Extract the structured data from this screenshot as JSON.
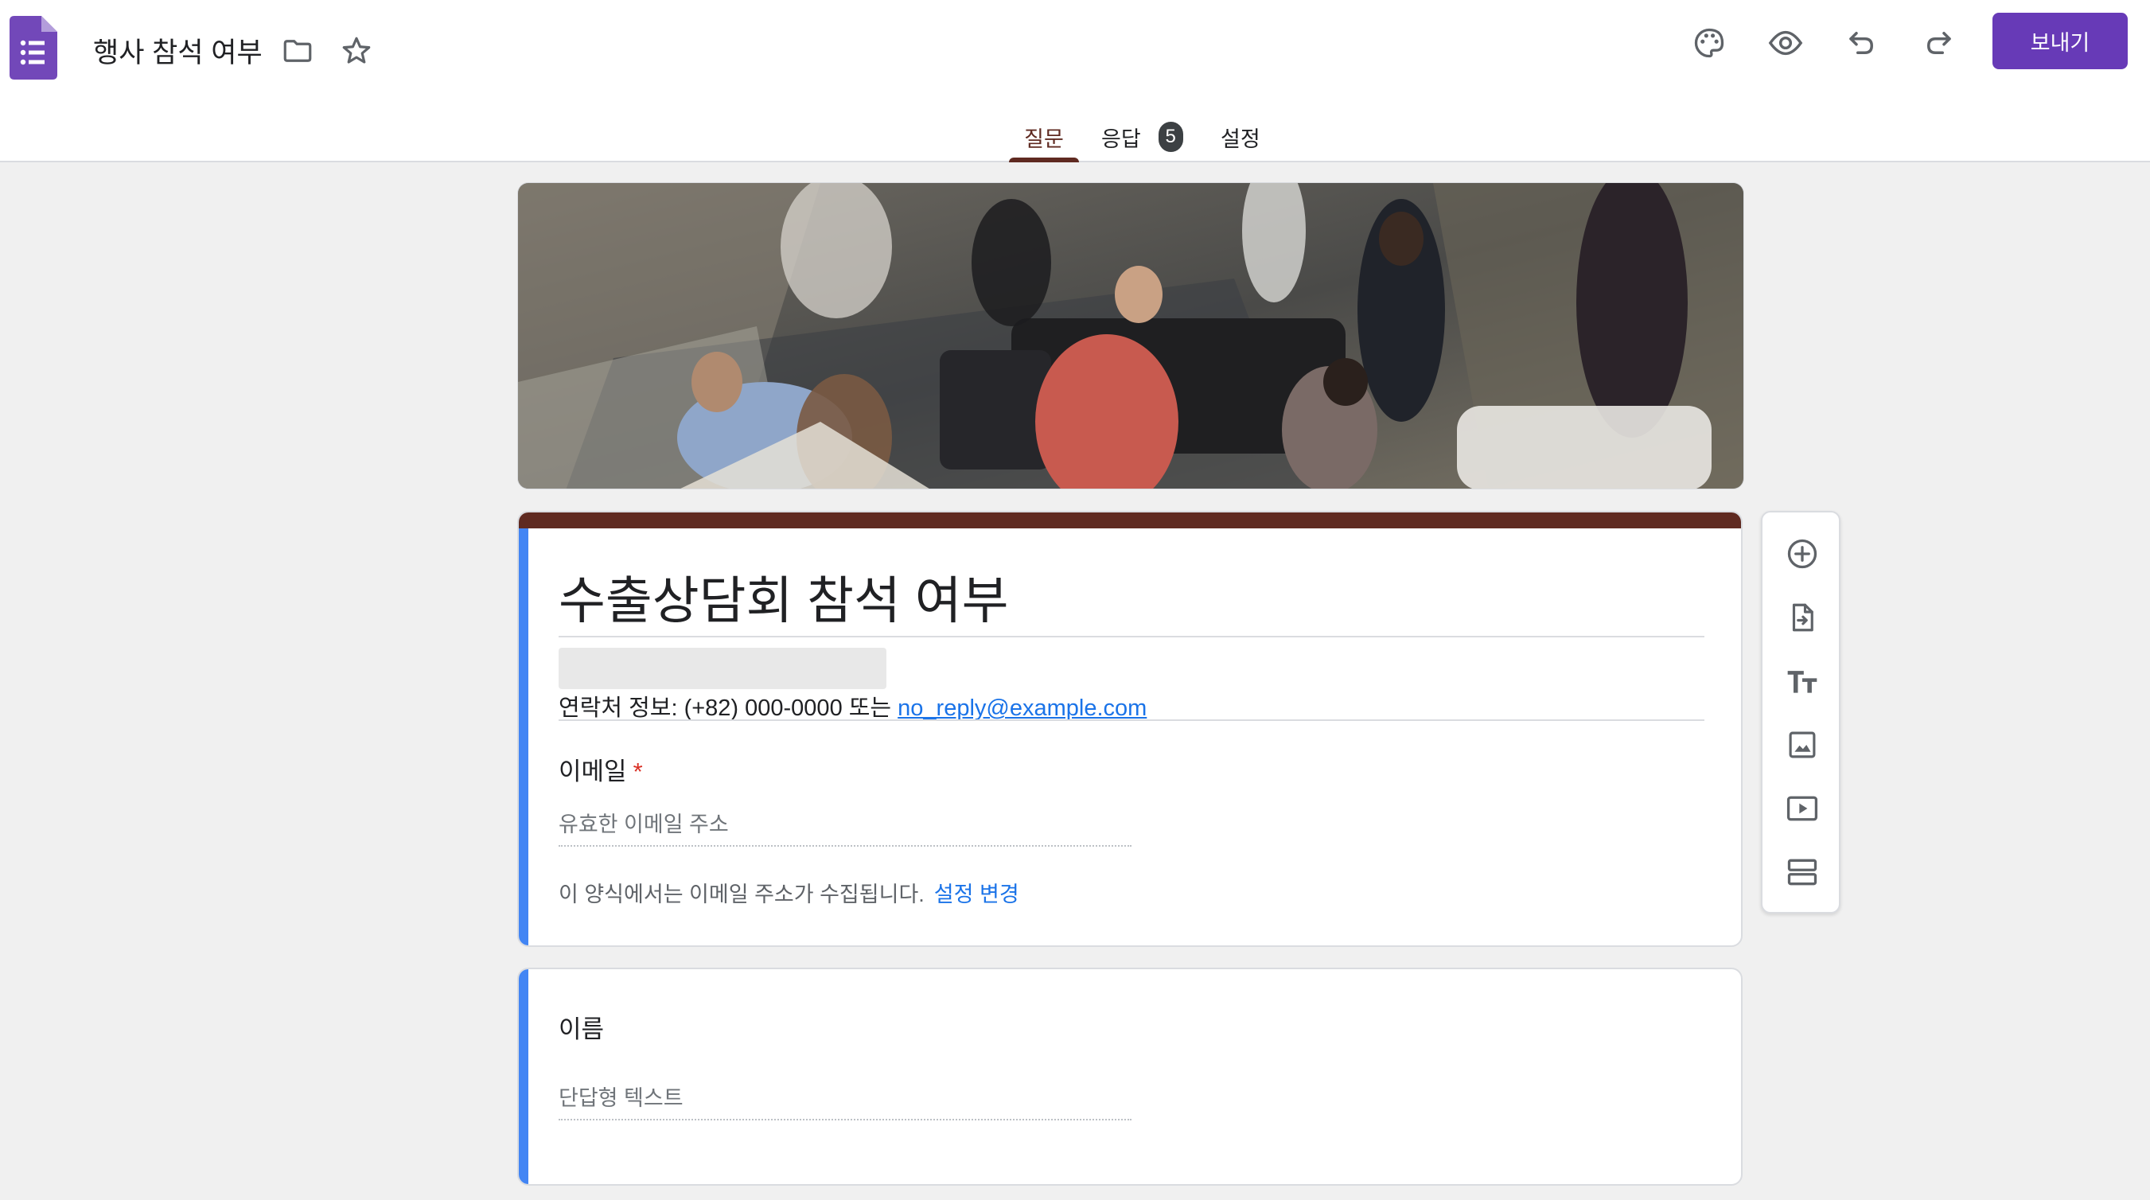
{
  "header": {
    "doc_title": "행사 참석 여부",
    "send_label": "보내기"
  },
  "tabs": [
    {
      "label": "질문",
      "active": true
    },
    {
      "label": "응답",
      "badge": "5"
    },
    {
      "label": "설정"
    }
  ],
  "form": {
    "title": "수출상담회 참석 여부",
    "contact_prefix": "연락처 정보: (+82) 000-0000 또는 ",
    "contact_email": "no_reply@example.com",
    "email_question": {
      "label": "이메일",
      "required_mark": "*",
      "placeholder": "유효한 이메일 주소",
      "note": "이 양식에서는 이메일 주소가 수집됩니다.",
      "note_link": "설정 변경"
    },
    "name_question": {
      "label": "이름",
      "placeholder": "단답형 텍스트"
    }
  },
  "colors": {
    "accent": "#673ab7",
    "theme": "#5f2a21",
    "focus_bar": "#4285f4",
    "link": "#1a73e8",
    "required": "#d93025"
  },
  "icons": [
    "forms-logo-icon",
    "folder-icon",
    "star-icon",
    "palette-icon",
    "eye-icon",
    "undo-icon",
    "redo-icon",
    "add-question-icon",
    "import-questions-icon",
    "add-title-icon",
    "add-image-icon",
    "add-video-icon",
    "add-section-icon"
  ]
}
